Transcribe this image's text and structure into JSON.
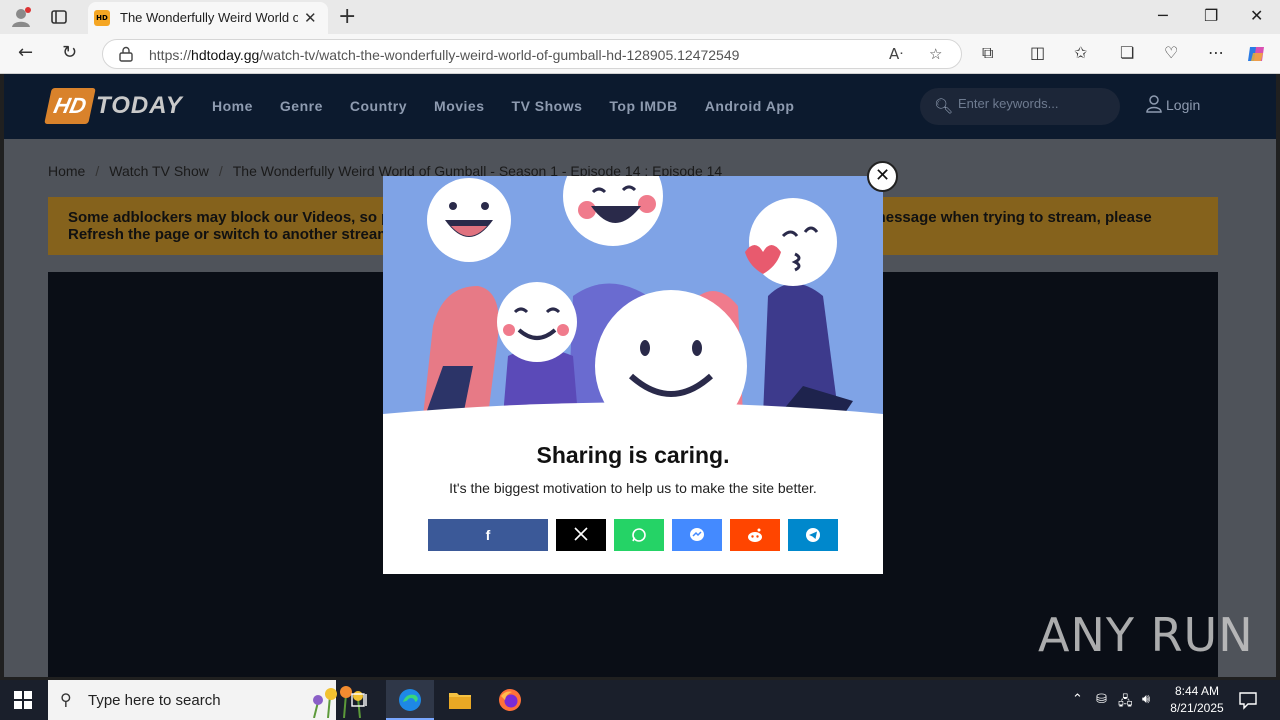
{
  "browser": {
    "tab_title": "The Wonderfully Weird World of G",
    "favicon_text": "HD",
    "url_prefix": "https://",
    "url_domain": "hdtoday.gg",
    "url_path": "/watch-tv/watch-the-wonderfully-weird-world-of-gumball-hd-128905.12472549"
  },
  "site": {
    "logo_hd": "HD",
    "logo_today": "TODAY",
    "menu": [
      "Home",
      "Genre",
      "Country",
      "Movies",
      "TV Shows",
      "Top IMDB",
      "Android App"
    ],
    "search_placeholder": "Enter keywords...",
    "login_label": "Login",
    "breadcrumb": {
      "home": "Home",
      "section": "Watch TV Show",
      "current": "The Wonderfully Weird World of Gumball - Season 1 - Episode 14 : Episode 14"
    },
    "notice": "Some adblockers may block our Videos, so please disable adblocker if you're having issues. If you get any error message when trying to stream, please Refresh the page or switch to another streaming server."
  },
  "modal": {
    "title": "Sharing is caring.",
    "subtitle": "It's the biggest motivation to help us to make the site better.",
    "close_glyph": "✕",
    "share_buttons": [
      {
        "name": "facebook",
        "glyph": "f",
        "color": "#3b5998"
      },
      {
        "name": "x",
        "glyph": "𝕏",
        "color": "#000000"
      },
      {
        "name": "whatsapp",
        "glyph": "",
        "color": "#25d366"
      },
      {
        "name": "messenger",
        "glyph": "",
        "color": "#448aff"
      },
      {
        "name": "reddit",
        "glyph": "",
        "color": "#ff4500"
      },
      {
        "name": "telegram",
        "glyph": "",
        "color": "#0088cc"
      }
    ]
  },
  "watermark": "ANY RUN",
  "taskbar": {
    "search_text": "Type here to search",
    "time": "8:44 AM",
    "date": "8/21/2025"
  },
  "colors": {
    "header": "#0c1a2e",
    "notice": "#85621c",
    "modal_sky": "#7fa3e6"
  }
}
